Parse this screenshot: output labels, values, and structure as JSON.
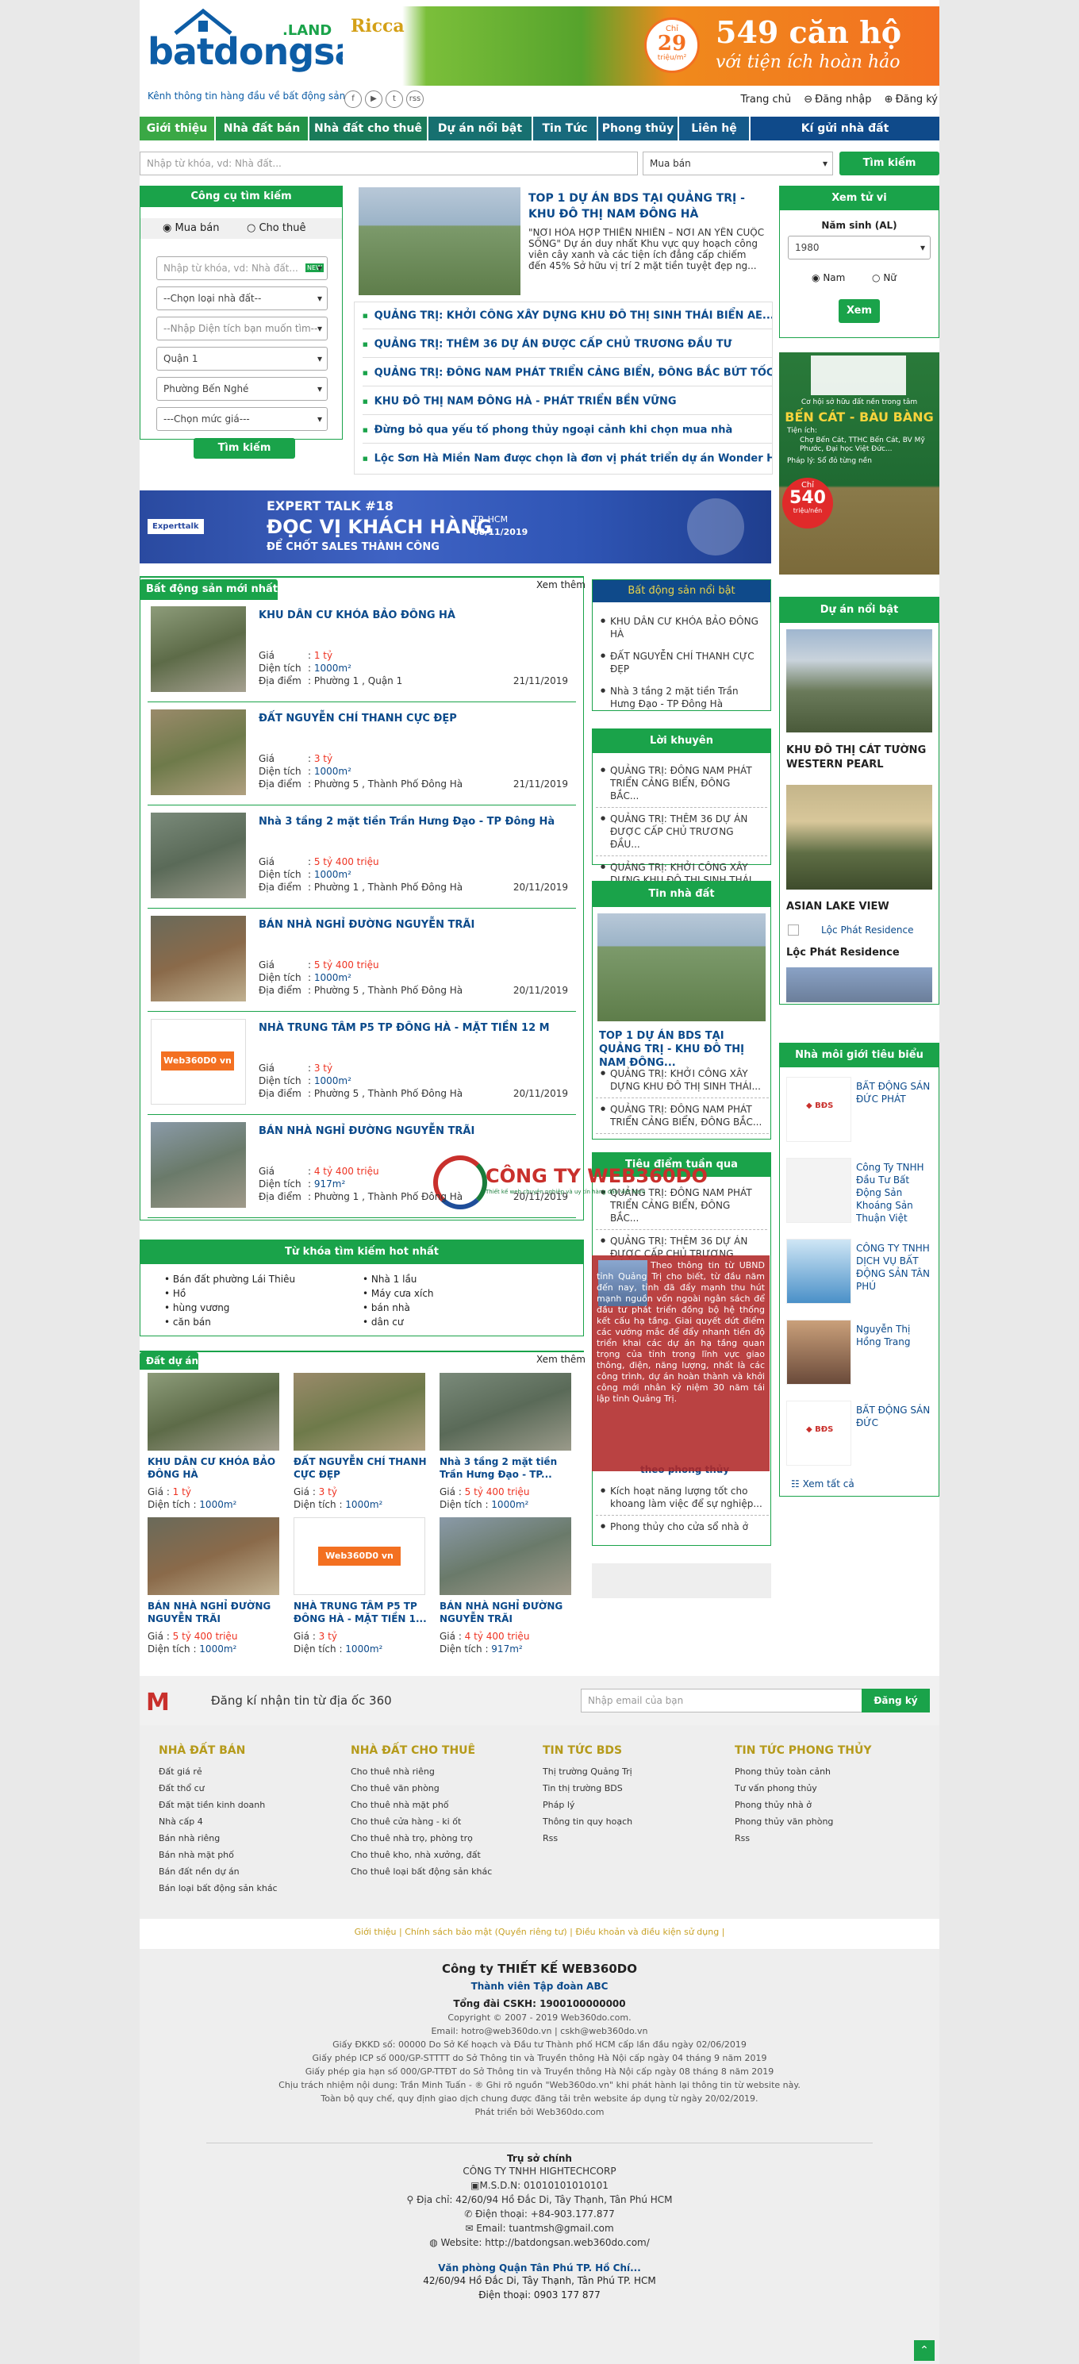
{
  "header": {
    "logo_text": "batdongsan",
    "logo_land": ".LAND",
    "slogan": "Kênh thông tin hàng đầu về bất động sản",
    "banner": {
      "brand": "Ricca",
      "price": "29",
      "price_unit": "triệu/m²",
      "price_prefix": "Chỉ",
      "headline": "549 căn hộ",
      "sub": "với tiện ích hoàn hảo"
    },
    "social": [
      "f",
      "▶",
      "t",
      "rss"
    ],
    "links": [
      "Trang chủ",
      "Đăng nhập",
      "Đăng ký"
    ]
  },
  "nav": [
    "Giới thiệu",
    "Nhà đất bán",
    "Nhà đất cho thuê",
    "Dự án nổi bật",
    "Tin Tức",
    "Phong thủy",
    "Liên hệ",
    "Kí gửi nhà đất"
  ],
  "search": {
    "placeholder": "Nhập từ khóa, vd: Nhà đất...",
    "type": "Mua bán",
    "button": "Tìm kiếm"
  },
  "tool": {
    "title": "Công cụ tìm kiếm",
    "tabs": [
      "Mua bán",
      "Cho thuê"
    ],
    "keyword": "Nhập từ khóa, vd: Nhà đất...",
    "new_badge": "NEW",
    "fields": [
      "--Chọn loại nhà đất--",
      "--Nhập Diện tích bạn muốn tìm--",
      "Quận 1",
      "Phường Bến Nghé",
      "---Chọn mức giá---"
    ],
    "button": "Tìm kiếm"
  },
  "featured": {
    "title": "TOP 1 DỰ ÁN BDS TẠI QUẢNG TRỊ - KHU ĐÔ THỊ NAM ĐÔNG HÀ",
    "desc": "\"NƠI HÒA HỢP THIÊN NHIÊN – NƠI AN YÊN CUỘC SỐNG\" Dự án duy nhất Khu vực quy hoạch công viên cây xanh và các tiện ích đẳng cấp chiếm đến 45% Sở hữu vị trí 2 mặt tiền tuyệt đẹp ng...",
    "links": [
      "QUẢNG TRỊ: KHỞI CÔNG XÂY DỰNG KHU ĐÔ THỊ SINH THÁI BIỂN AE...",
      "QUẢNG TRỊ: THÊM 36 DỰ ÁN ĐƯỢC CẤP CHỦ TRƯƠNG ĐẦU TƯ",
      "QUẢNG TRỊ: ĐÔNG NAM PHÁT TRIỂN CẢNG BIỂN, ĐÔNG BẮC BỨT TỐC...",
      "KHU ĐÔ THỊ NAM ĐÔNG HÀ - PHÁT TRIỂN BỀN VỮNG",
      "Đừng bỏ qua yếu tố phong thủy ngoại cảnh khi chọn mua nhà",
      "Lộc Sơn Hà Miền Nam được chọn là đơn vị phát triển dự án Wonder Home"
    ]
  },
  "expert": {
    "brand": "Experttalk",
    "title1": "EXPERT TALK #18",
    "title2": "ĐỌC VỊ KHÁCH HÀNG",
    "title3": "ĐỂ CHỐT SALES THÀNH CÔNG",
    "place": "TP. HCM",
    "date": "08/11/2019"
  },
  "latest": {
    "title": "Bất động sản mới nhất",
    "more": "Xem thêm",
    "labels": {
      "price": "Giá",
      "area": "Diện tích",
      "loc": "Địa điểm"
    },
    "items": [
      {
        "title": "KHU DÂN CƯ KHÓA BẢO ĐÔNG HÀ",
        "price": "1 tỷ",
        "area": "1000m²",
        "loc": "Phường 1 , Quận 1",
        "date": "21/11/2019"
      },
      {
        "title": "ĐẤT NGUYỄN CHÍ THANH CỰC ĐẸP",
        "price": "3 tỷ",
        "area": "1000m²",
        "loc": "Phường 5 , Thành Phố Đông Hà",
        "date": "21/11/2019"
      },
      {
        "title": "Nhà 3 tầng 2 mặt tiền Trần Hưng Đạo - TP Đông Hà",
        "price": "5 tỷ 400 triệu",
        "area": "1000m²",
        "loc": "Phường 1 , Thành Phố Đông Hà",
        "date": "20/11/2019"
      },
      {
        "title": "BÁN NHÀ NGHỈ ĐƯỜNG NGUYỄN TRÃI",
        "price": "5 tỷ 400 triệu",
        "area": "1000m²",
        "loc": "Phường 5 , Thành Phố Đông Hà",
        "date": "20/11/2019"
      },
      {
        "title": "NHÀ TRUNG TÂM P5 TP ĐÔNG HÀ - MẶT TIỀN 12 M",
        "price": "3 tỷ",
        "area": "1000m²",
        "loc": "Phường 5 , Thành Phố Đông Hà",
        "date": "20/11/2019"
      },
      {
        "title": "BÁN NHÀ NGHỈ ĐƯỜNG NGUYỄN TRÃI",
        "price": "4 tỷ 400 triệu",
        "area": "917m²",
        "loc": "Phường 1 , Thành Phố Đông Hà",
        "date": "20/11/2019"
      }
    ]
  },
  "hotkw": {
    "title": "Từ khóa tìm kiếm hot nhất",
    "left": [
      "Bán đất phường Lái Thiêu",
      "Hồ",
      "hùng vương",
      "căn bán"
    ],
    "right": [
      "Nhà 1 lầu",
      "Máy cưa xích",
      "bán nhà",
      "dân cư"
    ]
  },
  "project": {
    "title": "Đất dự án",
    "more": "Xem thêm",
    "items": [
      {
        "title": "KHU DÂN CƯ KHÓA BẢO ĐÔNG HÀ",
        "price": "1 tỷ",
        "area": "1000m²"
      },
      {
        "title": "ĐẤT NGUYỄN CHÍ THANH CỰC ĐẸP",
        "price": "3 tỷ",
        "area": "1000m²"
      },
      {
        "title": "Nhà 3 tầng 2 mặt tiền Trần Hưng Đạo - TP...",
        "price": "5 tỷ 400 triệu",
        "area": "1000m²"
      },
      {
        "title": "BÁN NHÀ NGHỈ ĐƯỜNG NGUYỄN TRÃI",
        "price": "5 tỷ 400 triệu",
        "area": "1000m²"
      },
      {
        "title": "NHÀ TRUNG TÂM P5 TP ĐÔNG HÀ - MẶT TIỀN 1...",
        "price": "3 tỷ",
        "area": "1000m²"
      },
      {
        "title": "BÁN NHÀ NGHỈ ĐƯỜNG NGUYỄN TRÃI",
        "price": "4 tỷ 400 triệu",
        "area": "917m²"
      }
    ]
  },
  "mid": {
    "hot": {
      "title": "Bất động sản nổi bật",
      "items": [
        "KHU DÂN CƯ KHÓA BẢO ĐÔNG HÀ",
        "ĐẤT NGUYỄN CHÍ THANH CỰC ĐẸP",
        "Nhà 3 tầng 2 mặt tiền Trần Hưng Đạo - TP Đông Hà"
      ]
    },
    "advice": {
      "title": "Lời khuyên",
      "items": [
        "QUẢNG TRỊ: ĐÔNG NAM PHÁT TRIỂN CẢNG BIỂN, ĐÔNG BẮC...",
        "QUẢNG TRỊ: THÊM 36 DỰ ÁN ĐƯỢC CẤP CHỦ TRƯƠNG ĐẦU...",
        "QUẢNG TRỊ: KHỞI CÔNG XÂY DỰNG KHU ĐÔ THỊ SINH THÁI..."
      ]
    },
    "news": {
      "title": "Tin nhà đất",
      "headline": "TOP 1 DỰ ÁN BDS TẠI QUẢNG TRỊ - KHU ĐÔ THỊ NAM ĐÔNG...",
      "items": [
        "QUẢNG TRỊ: KHỞI CÔNG XÂY DỰNG KHU ĐÔ THỊ SINH THÁI...",
        "QUẢNG TRỊ: ĐÔNG NAM PHÁT TRIỂN CẢNG BIỂN, ĐÔNG BẮC..."
      ]
    },
    "focus": {
      "title": "Tiêu điểm tuần qua",
      "items": [
        "QUẢNG TRỊ: ĐÔNG NAM PHÁT TRIỂN CẢNG BIỂN, ĐÔNG BẮC...",
        "QUẢNG TRỊ: THÊM 36 DỰ ÁN ĐƯỢC CẤP CHỦ TRƯƠNG ĐẦU..."
      ],
      "popup": "Theo thông tin từ UBND tỉnh Quảng Trị cho biết, từ đầu năm đến nay, tỉnh đã đẩy mạnh thu hút mạnh nguồn vốn ngoài ngân sách để đầu tư phát triển đồng bộ hệ thống kết cấu hạ tầng. Giai quyết dứt điểm các vướng mắc để đẩy nhanh tiến độ triển khai các dự án hạ tầng quan trọng của tỉnh trong lĩnh vực giao thông, điện, năng lượng, nhất là các công trình, dự án hoàn thành và khởi công mới nhân kỷ niệm 30 năm tái lập tỉnh Quảng Trị."
    },
    "fengshui": {
      "title": "theo phong thủy",
      "items": [
        "Kích hoạt năng lượng tốt cho khoang làm việc để sự nghiệp...",
        "Phong thủy cho cửa sổ nhà ở"
      ]
    }
  },
  "right": {
    "age": {
      "title": "Xem tử vi",
      "label": "Năm sinh (AL)",
      "year": "1980",
      "genders": [
        "Nam",
        "Nữ"
      ],
      "button": "Xem"
    },
    "ad": {
      "l1": "Cơ hội sở hữu đất nền trong tâm",
      "l2": "BẾN CÁT - BÀU BÀNG",
      "l3": "Tiện ích:",
      "l4": "Chợ Bến Cát, TTHC Bến Cát, BV Mỹ Phước, Đại học Việt Đức...",
      "l5": "Pháp lý: Sổ đỏ từng nền",
      "p1": "Chỉ",
      "p2": "540",
      "p3": "triệu/nền"
    },
    "projects": {
      "title": "Dự án nổi bật",
      "items": [
        "KHU ĐÔ THỊ CÁT TƯỜNG WESTERN PEARL",
        "ASIAN LAKE VIEW",
        "Lộc Phát Residence",
        "Lộc Phát Residence"
      ]
    },
    "brokers": {
      "title": "Nhà môi giới tiêu biểu",
      "items": [
        "BẤT ĐỘNG SẢN ĐỨC PHÁT",
        "Công Ty TNHH Đầu Tư Bất Động Sản Khoáng Sản Thuận Việt",
        "CÔNG TY TNHH DỊCH VỤ BẤT ĐỘNG SẢN TÂN PHÚ",
        "Nguyễn Thị Hồng Trang",
        "BẤT ĐỘNG SẢN ĐỨC"
      ],
      "more": "Xem tất cả"
    }
  },
  "watermark": {
    "title": "CÔNG TY WEB360DO",
    "sub": "Thiết kế web chuyên nghiệp và uy tín hàng đầu Việt Nam"
  },
  "newsletter": {
    "label": "Đăng kí nhận tin từ địa ốc 360",
    "placeholder": "Nhập email của bạn",
    "button": "Đăng ký"
  },
  "footer_cols": [
    {
      "title": "NHÀ ĐẤT BÁN",
      "items": [
        "Đất giá rẻ",
        "Đất thổ cư",
        "Đất mặt tiền kinh doanh",
        "Nhà cấp 4",
        "Bán nhà riêng",
        "Bán nhà mặt phố",
        "Bán đất nền dự án",
        "Bán loại bất động sản khác"
      ]
    },
    {
      "title": "NHÀ ĐẤT CHO THUÊ",
      "items": [
        "Cho thuê nhà riêng",
        "Cho thuê văn phòng",
        "Cho thuê nhà mặt phố",
        "Cho thuê cửa hàng - ki ốt",
        "Cho thuê nhà trọ, phòng trọ",
        "Cho thuê kho, nhà xưởng, đất",
        "Cho thuê loại bất động sản khác"
      ]
    },
    {
      "title": "TIN TỨC BDS",
      "items": [
        "Thị trường Quảng Trị",
        "Tin thị trường BDS",
        "Pháp lý",
        "Thông tin quy hoạch",
        "Rss"
      ]
    },
    {
      "title": "TIN TỨC PHONG THỦY",
      "items": [
        "Phong thủy toàn cảnh",
        "Tư vấn phong thủy",
        "Phong thủy nhà ở",
        "Phong thủy văn phòng",
        "Rss"
      ]
    }
  ],
  "footer_links": [
    "Giới thiệu",
    "Chính sách bảo mật (Quyền riêng tư)",
    "Điều khoản và điều kiện sử dụng"
  ],
  "company": {
    "name": "Công ty THIẾT KẾ WEB360DO",
    "member": "Thành viên Tập đoàn ABC",
    "hotline": "Tổng đài CSKH: 1900100000000",
    "lines": [
      "Copyright © 2007 - 2019 Web360do.com.",
      "Email: hotro@web360do.vn | cskh@web360do.vn",
      "Giấy ĐKKD số: 00000   Do Sở Kế hoạch và Đầu tư Thành phố HCM cấp lần đầu ngày 02/06/2019",
      "Giấy phép ICP số 000/GP-STTTT do Sở Thông tin và Truyền thông Hà Nội cấp ngày 04 tháng 9 năm 2019",
      "Giấy phép gia hạn số 000/GP-TTĐT do Sở Thông tin và Truyền thông Hà Nội cấp ngày 08 tháng 8 năm 2019",
      "Chịu trách nhiệm nội dung: Trần Minh Tuấn - ® Ghi rõ nguồn \"Web360do.vn\" khi phát hành lại thông tin từ website này.",
      "Toàn bộ quy chế, quy định giao dịch chung được đăng tải trên website áp dụng từ ngày 20/02/2019.",
      "Phát triển bởi Web360do.com"
    ],
    "hq_title": "Trụ sở chính",
    "hq": [
      "CÔNG TY TNHH HIGHTECHCORP",
      "M.S.D.N: 01010101010101",
      "Địa chỉ: 42/60/94 Hồ Đắc Di, Tây Thạnh, Tân Phú HCM",
      "Điện thoại: +84-903.177.877",
      "Email: tuantmsh@gmail.com",
      "Website: http://batdongsan.web360do.com/"
    ],
    "branch_title": "Văn phòng Quận Tân Phú TP. Hồ Chí...",
    "branch": [
      "42/60/94 Hồ Đắc Di, Tây Thạnh, Tân Phú TP. HCM",
      "Điện thoại: 0903 177 877"
    ]
  },
  "colors": {
    "green": "#1aa34a",
    "blue": "#0b4a8b",
    "red": "#e32222"
  }
}
